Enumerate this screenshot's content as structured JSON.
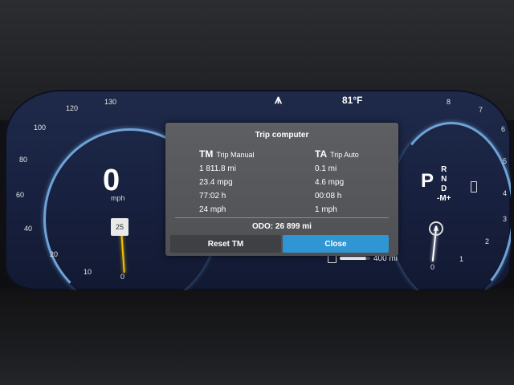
{
  "cluster": {
    "speed": "0",
    "speed_unit": "mph",
    "speed_limit": "25",
    "outside_temp": "81°F",
    "gear_current": "P",
    "gear_options": [
      "R",
      "N",
      "D",
      "-M+"
    ],
    "range": "400 mi",
    "auto_hold": "A",
    "speedo_ticks": [
      "130",
      "120",
      "100",
      "80",
      "60",
      "40",
      "20",
      "10",
      "0"
    ],
    "rpm_ticks": [
      "8",
      "7",
      "6",
      "5",
      "4",
      "3",
      "2",
      "1",
      "0"
    ]
  },
  "trip_computer": {
    "title": "Trip computer",
    "manual": {
      "abbr": "TM",
      "label": "Trip Manual",
      "distance": "1 811.8 mi",
      "economy": "23.4 mpg",
      "time": "77:02 h",
      "avg_speed": "24 mph"
    },
    "auto": {
      "abbr": "TA",
      "label": "Trip Auto",
      "distance": "0.1 mi",
      "economy": "4.6 mpg",
      "time": "00:08 h",
      "avg_speed": "1 mph"
    },
    "odometer": "ODO:  26 899 mi",
    "reset_label": "Reset TM",
    "close_label": "Close"
  },
  "colors": {
    "accent": "#2f95d3",
    "needle": "#f3c200",
    "ring": "#6fa3d6"
  }
}
